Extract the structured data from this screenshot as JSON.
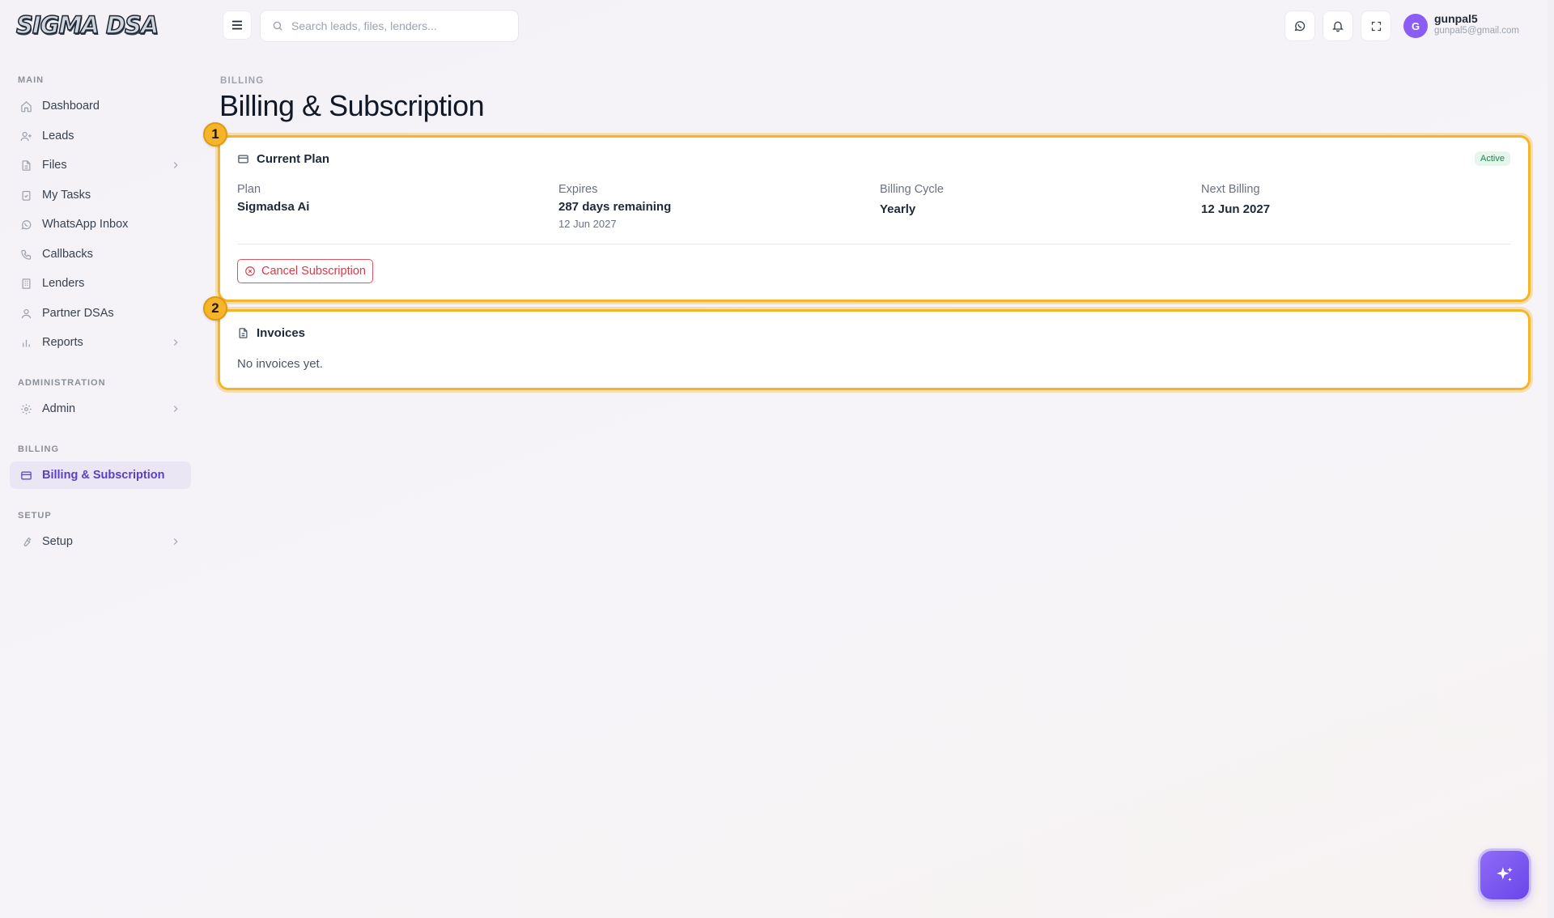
{
  "app": {
    "logo_text": "SIGMA DSA"
  },
  "sidebar": {
    "sections": {
      "main": "MAIN",
      "administration": "ADMINISTRATION",
      "billing": "BILLING",
      "setup": "SETUP"
    },
    "items": {
      "dashboard": "Dashboard",
      "leads": "Leads",
      "files": "Files",
      "tasks": "My Tasks",
      "whatsapp": "WhatsApp Inbox",
      "callbacks": "Callbacks",
      "lenders": "Lenders",
      "partners": "Partner DSAs",
      "reports": "Reports",
      "admin": "Admin",
      "billing": "Billing & Subscription",
      "setup": "Setup"
    }
  },
  "topbar": {
    "search_placeholder": "Search leads, files, lenders...",
    "user": {
      "initial": "G",
      "name": "gunpal5",
      "email": "gunpal5@gmail.com"
    }
  },
  "page": {
    "breadcrumb": "BILLING",
    "title": "Billing & Subscription"
  },
  "markers": {
    "one": "1",
    "two": "2"
  },
  "plan_card": {
    "title": "Current Plan",
    "status": "Active",
    "plan_label": "Plan",
    "plan_value": "Sigmadsa Ai",
    "expires_label": "Expires",
    "expires_value": "287 days remaining",
    "expires_date": "12 Jun 2027",
    "cycle_label": "Billing Cycle",
    "cycle_value": "Yearly",
    "next_label": "Next Billing",
    "next_value": "12 Jun 2027",
    "cancel_label": "Cancel Subscription"
  },
  "invoices_card": {
    "title": "Invoices",
    "empty": "No invoices yet."
  },
  "colors": {
    "accent": "#5b3fc4",
    "highlight": "#f5b52a",
    "danger": "#d63b48",
    "success": "#138a4a"
  }
}
